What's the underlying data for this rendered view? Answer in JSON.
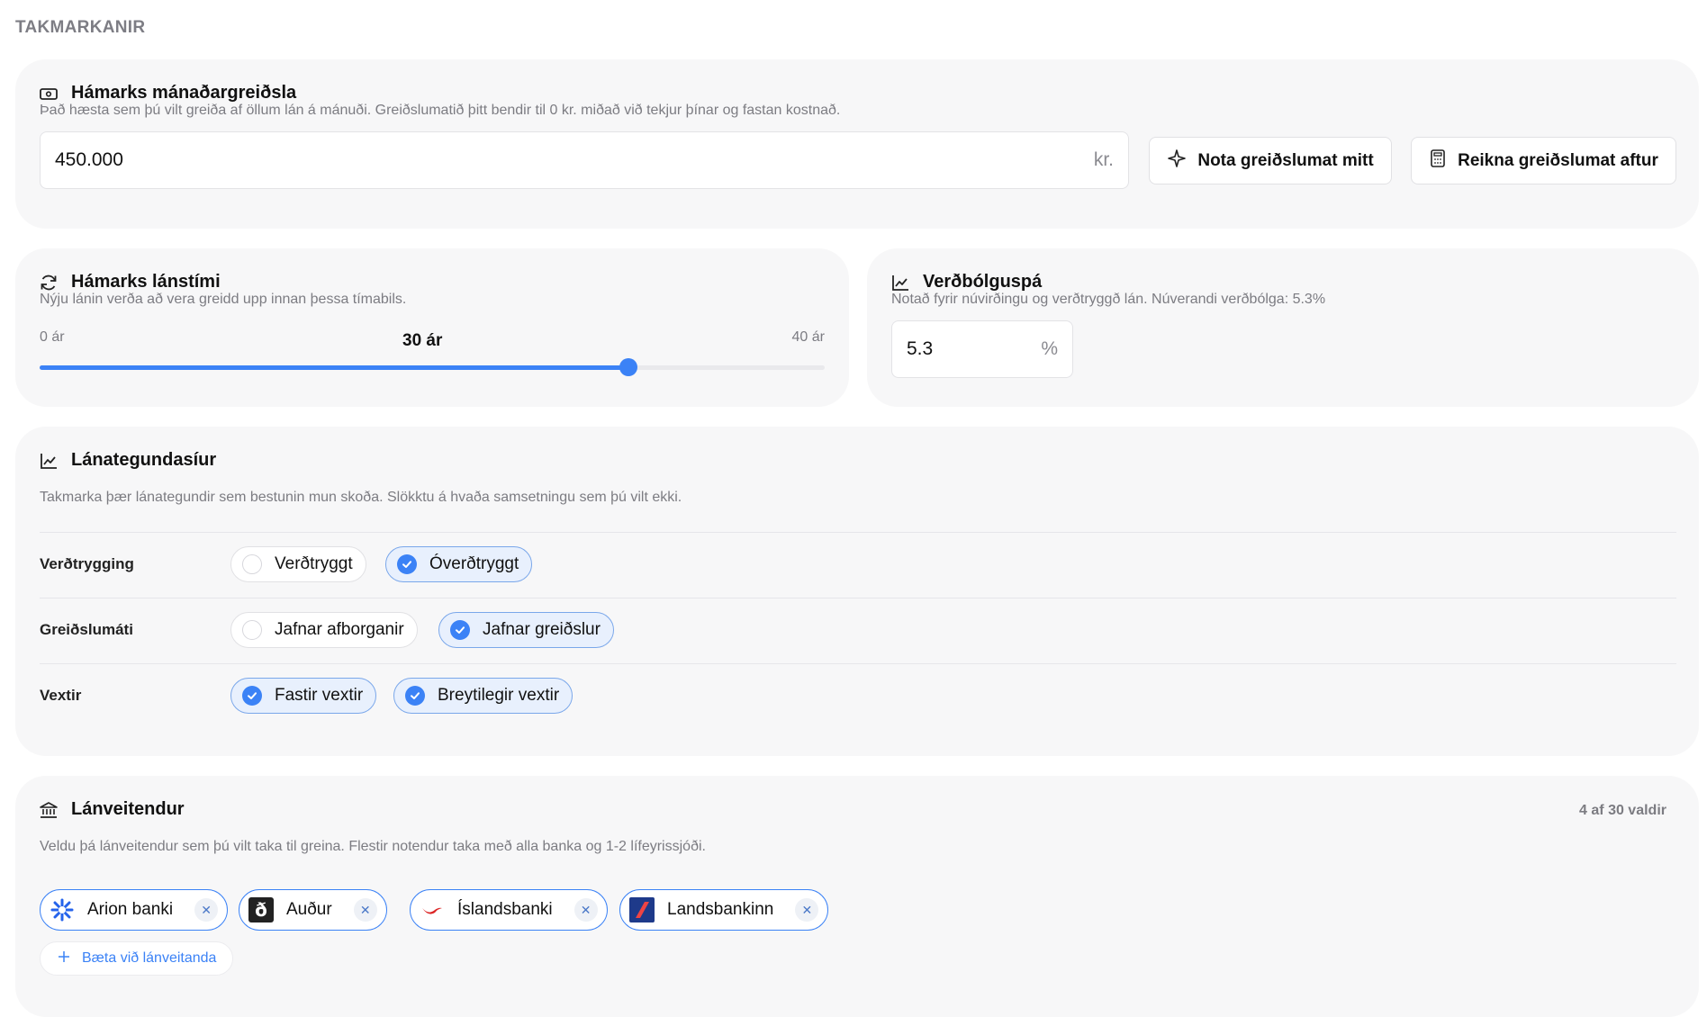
{
  "section_heading": "TAKMARKANIR",
  "monthly_payment": {
    "title": "Hámarks mánaðargreiðsla",
    "description": "Það hæsta sem þú vilt greiða af öllum lán á mánuði. Greiðslumatið þitt bendir til 0 kr. miðað við tekjur þínar og fastan kostnað.",
    "value": "450.000",
    "unit": "kr.",
    "use_assessment_label": "Nota greiðslumat mitt",
    "recalculate_label": "Reikna greiðslumat aftur"
  },
  "loan_term": {
    "title": "Hámarks lánstími",
    "description": "Nýju lánin verða að vera greidd upp innan þessa tímabils.",
    "min_label": "0 ár",
    "value_label": "30 ár",
    "max_label": "40 ár",
    "min": 0,
    "max": 40,
    "value": 30
  },
  "inflation": {
    "title": "Verðbólguspá",
    "description": "Notað fyrir núvirðingu og verðtryggð lán. Núverandi verðbólga: 5.3%",
    "value": "5.3",
    "unit": "%"
  },
  "loan_filters": {
    "title": "Lánategundasíur",
    "description": "Takmarka þær lánategundir sem bestunin mun skoða. Slökktu á hvaða samsetningu sem þú vilt ekki.",
    "rows": [
      {
        "label": "Verðtrygging",
        "options": [
          {
            "label": "Verðtryggt",
            "checked": false
          },
          {
            "label": "Óverðtryggt",
            "checked": true
          }
        ]
      },
      {
        "label": "Greiðslumáti",
        "options": [
          {
            "label": "Jafnar afborganir",
            "checked": false
          },
          {
            "label": "Jafnar greiðslur",
            "checked": true
          }
        ]
      },
      {
        "label": "Vextir",
        "options": [
          {
            "label": "Fastir vextir",
            "checked": true
          },
          {
            "label": "Breytilegir vextir",
            "checked": true
          }
        ]
      }
    ]
  },
  "lenders": {
    "title": "Lánveitendur",
    "count_text": "4 af 30 valdir",
    "description": "Veldu þá lánveitendur sem þú vilt taka til greina. Flestir notendur taka með alla banka og 1-2 lífeyrissjóði.",
    "selected": [
      {
        "name": "Arion banki",
        "icon": "arion-logo"
      },
      {
        "name": "Auður",
        "icon": "audur-logo"
      },
      {
        "name": "Íslandsbanki",
        "icon": "islandsbanki-logo"
      },
      {
        "name": "Landsbankinn",
        "icon": "landsbankinn-logo"
      }
    ],
    "add_label": "Bæta við lánveitanda"
  },
  "colors": {
    "accent": "#3b82f6",
    "card_bg": "#f7f7f8",
    "chip_selected_bg": "#e8f0fd"
  }
}
